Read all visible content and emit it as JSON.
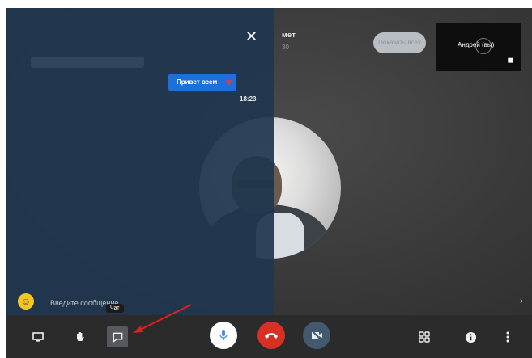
{
  "meeting": {
    "name_fragment": "мет",
    "sub_fragment": "30"
  },
  "pill_label": "Показать всех",
  "self_tile": {
    "name": "Андрей (вы)"
  },
  "chat": {
    "messages": [
      {
        "text": "Привет всем",
        "time": "18:23"
      }
    ],
    "input_placeholder": "Введите сообщение"
  },
  "tooltip": "Чат",
  "icons": {
    "close": "close-icon",
    "emoji": "emoji-icon",
    "present": "present-screen-icon",
    "hand": "raise-hand-icon",
    "chat": "chat-icon",
    "mic": "mic-icon",
    "end": "end-call-icon",
    "camera": "camera-off-icon",
    "grid": "grid-view-icon",
    "info": "info-icon",
    "more": "more-vert-icon",
    "chevron": "chevron-right-icon"
  },
  "colors": {
    "chat_panel": "#20374F",
    "bubble": "#1E6FD9",
    "end_call": "#D93025",
    "arrow": "#E0201E"
  }
}
